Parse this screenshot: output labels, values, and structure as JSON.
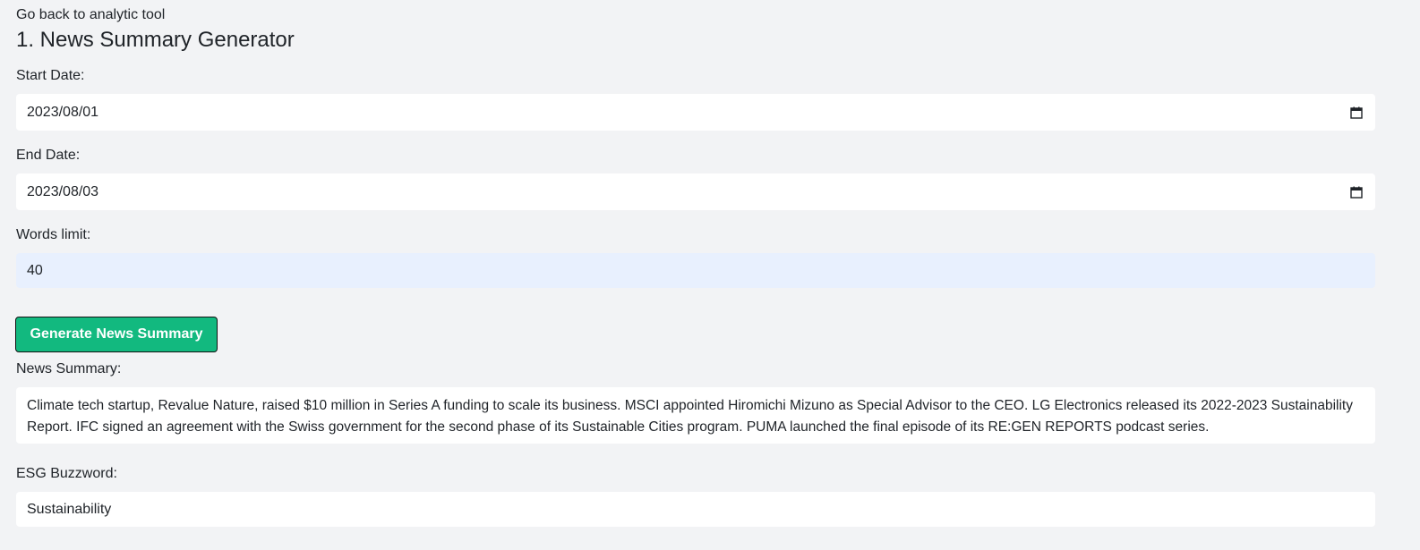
{
  "nav": {
    "back_link": "Go back to analytic tool"
  },
  "page": {
    "title": "1. News Summary Generator"
  },
  "form": {
    "start_date": {
      "label": "Start Date:",
      "value": "2023/08/01",
      "icon": "calendar-icon"
    },
    "end_date": {
      "label": "End Date:",
      "value": "2023/08/03",
      "icon": "calendar-icon"
    },
    "words_limit": {
      "label": "Words limit:",
      "value": "40"
    },
    "generate_button": "Generate News Summary"
  },
  "output": {
    "news_summary": {
      "label": "News Summary:",
      "text": "Climate tech startup, Revalue Nature, raised $10 million in Series A funding to scale its business. MSCI appointed Hiromichi Mizuno as Special Advisor to the CEO. LG Electronics released its 2022-2023 Sustainability Report. IFC signed an agreement with the Swiss government for the second phase of its Sustainable Cities program. PUMA launched the final episode of its RE:GEN REPORTS podcast series."
    },
    "esg_buzzword": {
      "label": "ESG Buzzword:",
      "value": "Sustainability"
    }
  },
  "colors": {
    "background": "#f2f3f5",
    "button": "#12b97f",
    "autofill": "#e8f0fe"
  }
}
